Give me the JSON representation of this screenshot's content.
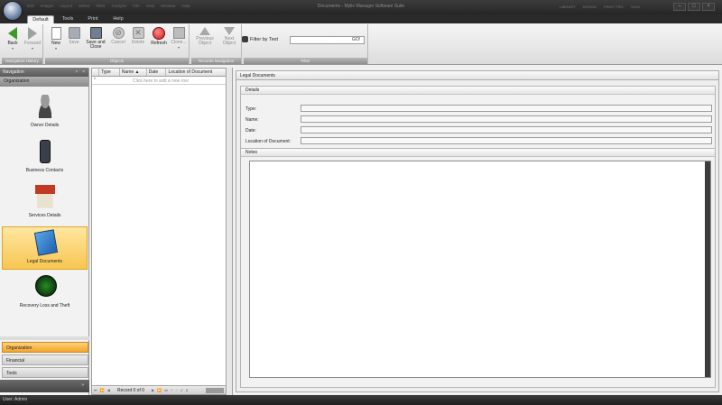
{
  "window": {
    "title": "Documents - Mylio Manager Software Suite",
    "quick_access": [
      "Edit",
      "Images",
      "Layout",
      "Select",
      "Filter",
      "Analysis",
      "File",
      "View",
      "Window",
      "Help"
    ],
    "right_menus": [
      "LIBRARY",
      "DESIGN",
      "PRINT PRO",
      "TASK"
    ],
    "minimize": "–",
    "maximize": "□",
    "close": "×"
  },
  "ribbon_tabs": [
    "Default",
    "Tools",
    "Print",
    "Help"
  ],
  "ribbon": {
    "groups": {
      "navigation_history": "Navigation History",
      "objects": "Objects",
      "records_navigation": "Records Navigation",
      "filter": "Filter"
    },
    "buttons": {
      "back": "Back",
      "forward": "Forward",
      "new": "New",
      "save": "Save",
      "save_close": "Save and Close",
      "cancel": "Cancel",
      "delete": "Delete",
      "refresh": "Refresh",
      "clone": "Clone...",
      "previous_object": "Previous Object",
      "next_object": "Next Object"
    },
    "filter_label": "Filter by Text",
    "filter_value": "",
    "go": "GO!"
  },
  "navigation": {
    "header": "Navigation",
    "pin": "ᵖ",
    "close": "×",
    "group": "Organization",
    "items": [
      {
        "label": "Owner Details",
        "icon": "person-icon"
      },
      {
        "label": "Business Contacts",
        "icon": "phone-icon"
      },
      {
        "label": "Services Details",
        "icon": "house-icon"
      },
      {
        "label": "Legal Documents",
        "icon": "notebook-icon"
      },
      {
        "label": "Recovery Loss and Theft",
        "icon": "radar-icon"
      }
    ],
    "categories": [
      "Organization",
      "Financial",
      "Tools"
    ],
    "chevron": "»"
  },
  "grid": {
    "columns": [
      "Type",
      "Name ▲",
      "Date",
      "Location of Document"
    ],
    "new_row_marker": "*",
    "new_row_hint": "Click here to add a new row",
    "record_text": "Record 0 of 0",
    "nav_left": "⏮ ⏪ ◀",
    "nav_right": "▶ ⏩ ⏭ + − ✓ ✗"
  },
  "detail": {
    "tab": "Legal Documents",
    "details_header": "Details",
    "fields": [
      {
        "label": "Type:",
        "value": ""
      },
      {
        "label": "Name:",
        "value": ""
      },
      {
        "label": "Date:",
        "value": ""
      },
      {
        "label": "Location of Document:",
        "value": ""
      }
    ],
    "notes_header": "Notes",
    "notes_value": ""
  },
  "status": {
    "user": "User: Admin"
  },
  "colors": {
    "accent_selected": "#f7c651",
    "chrome_dark": "#262626",
    "refresh_red": "#d01818",
    "back_green": "#3c9a2a"
  }
}
